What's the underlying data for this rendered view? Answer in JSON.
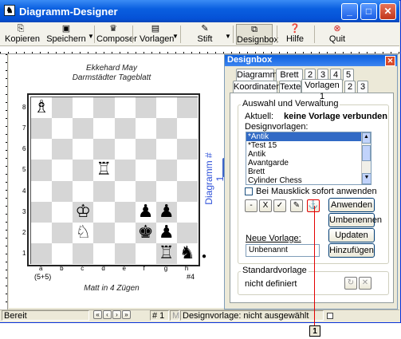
{
  "window": {
    "title": "Diagramm-Designer"
  },
  "toolbar": {
    "items": [
      {
        "label": "Kopieren",
        "icon": "copy-icon"
      },
      {
        "label": "Speichern",
        "icon": "save-icon"
      },
      {
        "label": "Composer",
        "icon": "crown-icon"
      },
      {
        "label": "Vorlagen",
        "icon": "templates-icon"
      },
      {
        "label": "Stift",
        "icon": "pencil-icon"
      },
      {
        "label": "Designbox",
        "icon": "designbox-icon"
      },
      {
        "label": "Hilfe",
        "icon": "help-icon"
      },
      {
        "label": "Quit",
        "icon": "quit-icon"
      }
    ]
  },
  "diagram": {
    "author": "Ekkehard May",
    "source": "Darmstädter Tageblatt",
    "side_label": "Diagramm # 1",
    "files": [
      "a",
      "b",
      "c",
      "d",
      "e",
      "f",
      "g",
      "h"
    ],
    "ranks": [
      "8",
      "7",
      "6",
      "5",
      "4",
      "3",
      "2",
      "1"
    ],
    "piece_count": "(5+5)",
    "move_number": "#4",
    "stipulation": "Matt in 4 Zügen",
    "pieces": [
      {
        "glyph": "♗",
        "name": "white-bishop",
        "file": "a",
        "rank": "8"
      },
      {
        "glyph": "♖",
        "name": "white-rook",
        "file": "d",
        "rank": "5"
      },
      {
        "glyph": "♔",
        "name": "white-king",
        "file": "c",
        "rank": "3"
      },
      {
        "glyph": "♟",
        "name": "black-pawn",
        "file": "f",
        "rank": "3"
      },
      {
        "glyph": "♟",
        "name": "black-pawn",
        "file": "g",
        "rank": "3"
      },
      {
        "glyph": "♘",
        "name": "white-knight",
        "file": "c",
        "rank": "2"
      },
      {
        "glyph": "♚",
        "name": "black-king",
        "file": "f",
        "rank": "2"
      },
      {
        "glyph": "♟",
        "name": "black-pawn",
        "file": "g",
        "rank": "2"
      },
      {
        "glyph": "♖",
        "name": "white-rook",
        "file": "g",
        "rank": "1"
      },
      {
        "glyph": "♞",
        "name": "black-knight",
        "file": "h",
        "rank": "1"
      }
    ]
  },
  "designbox": {
    "title": "Designbox",
    "tabs_row1": [
      "Diagramm",
      "Brett 1",
      "2",
      "3",
      "4",
      "5"
    ],
    "tabs_row2": [
      "Koordinaten",
      "Texte",
      "Vorlagen 1",
      "2",
      "3"
    ],
    "group_title": "Auswahl und Verwaltung",
    "current_label": "Aktuell:",
    "current_value": "keine Vorlage verbunden",
    "templates_label": "Designvorlagen:",
    "templates": [
      "*Antik",
      "*Test 15",
      "Antik",
      "Avantgarde",
      "Brett",
      "Cylinder Chess"
    ],
    "selected_template": "*Antik",
    "checkbox_label": "Bei Mausklick sofort anwenden",
    "small_buttons": [
      "-",
      "X",
      "✓",
      "✎",
      "⚓"
    ],
    "btn_apply": "Anwenden",
    "btn_rename": "Umbenennen",
    "btn_update": "Updaten",
    "btn_add": "Hinzufügen",
    "new_label": "Neue Vorlage:",
    "new_value": "Unbenannt",
    "std_group": "Standardvorlage",
    "std_value": "nicht definiert"
  },
  "statusbar": {
    "left": "Bereit",
    "nav": [
      "«",
      "‹",
      "›",
      "»"
    ],
    "page": "# 1",
    "mode": "M",
    "message": "Designvorlage: nicht ausgewählt"
  },
  "callout": {
    "number": "1"
  }
}
